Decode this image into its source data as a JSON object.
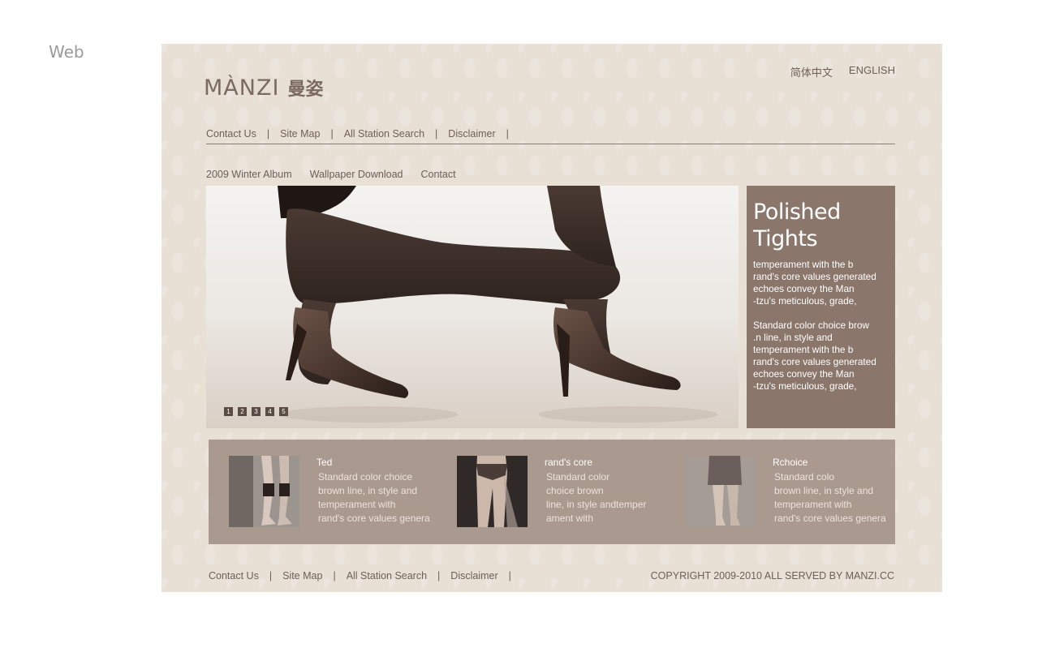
{
  "canvas_label": "Web",
  "brand": {
    "latin": "MÀNZI",
    "cjk": "曼姿"
  },
  "language": {
    "chinese": "简体中文",
    "english": "ENGLISH"
  },
  "top_nav": [
    "Contact Us",
    "Site Map",
    "All Station Search",
    "Disclaimer"
  ],
  "separator": "|",
  "sub_nav": [
    "2009 Winter Album",
    "Wallpaper Download",
    "Contact"
  ],
  "hero": {
    "pages": [
      "1",
      "2",
      "3",
      "4",
      "5"
    ]
  },
  "promo": {
    "title_line1": "Polished",
    "title_line2": "Tights",
    "text": "temperament with the b\nrand's core values generated\nechoes convey the Man\n-tzu's meticulous, grade,\n\nStandard color choice brow\n.n line, in style and\ntemperament with the b\nrand's core values generated\nechoes convey the Man\n-tzu's meticulous, grade,"
  },
  "products": [
    {
      "title": "Ted",
      "desc": "Standard color choice\nbrown line, in style and\ntemperament with\nrand's core values genera"
    },
    {
      "title": "rand's core",
      "desc": "Standard color\nchoice brown\nline, in style andtemper\nament with"
    },
    {
      "title": "Rchoice",
      "desc": "Standard colo\nbrown line, in style and\ntemperament with\nrand's core values genera"
    }
  ],
  "footer_nav": [
    "Contact Us",
    "Site Map",
    "All Station Search",
    "Disclaimer"
  ],
  "copyright": "COPYRIGHT 2009-2010 ALL SERVED BY MANZI.CC",
  "colors": {
    "page_bg": "#e8dfd5",
    "promo_bg": "#8b766b",
    "products_bg": "#aa998f",
    "text": "#6d6058"
  }
}
